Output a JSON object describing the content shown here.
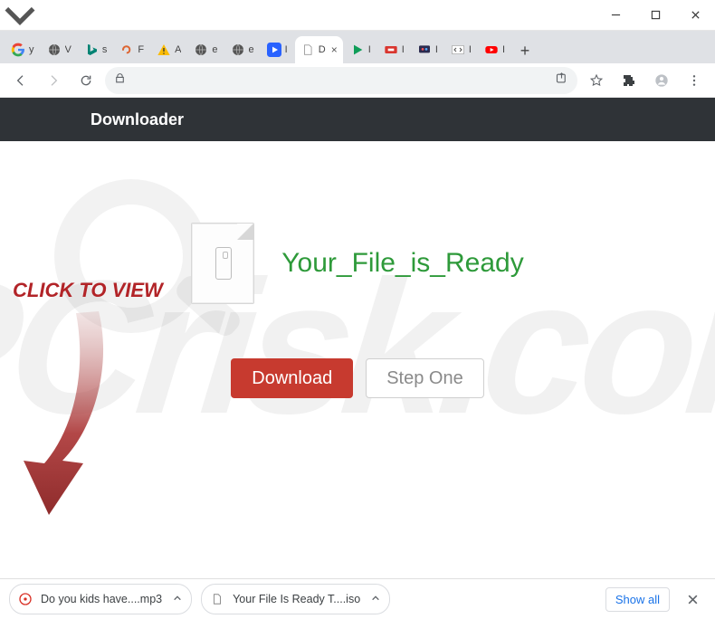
{
  "page": {
    "header_title": "Downloader",
    "click_to_view": "CLICK TO VIEW",
    "ready_text": "Your_File_is_Ready",
    "download_button": "Download",
    "step_one_button": "Step One",
    "watermark_text": "PCrisk.com"
  },
  "tabs": [
    {
      "label": "y",
      "favicon": "google"
    },
    {
      "label": "V",
      "favicon": "globe-dark"
    },
    {
      "label": "s",
      "favicon": "bing"
    },
    {
      "label": "F",
      "favicon": "red-swirl"
    },
    {
      "label": "A",
      "favicon": "warn"
    },
    {
      "label": "e",
      "favicon": "globe-dark"
    },
    {
      "label": "e",
      "favicon": "globe-dark"
    },
    {
      "label": "I",
      "favicon": "blue-play"
    },
    {
      "label": "D",
      "favicon": "doc",
      "active": true
    },
    {
      "label": "I",
      "favicon": "green-play"
    },
    {
      "label": "I",
      "favicon": "red-rect"
    },
    {
      "label": "I",
      "favicon": "tv"
    },
    {
      "label": "I",
      "favicon": "code"
    },
    {
      "label": "I",
      "favicon": "youtube"
    }
  ],
  "downloads": {
    "items": [
      {
        "name": "Do you kids have....mp3",
        "type": "audio"
      },
      {
        "name": "Your File Is Ready T....iso",
        "type": "file"
      }
    ],
    "show_all": "Show all"
  },
  "omnibox": {
    "value": ""
  }
}
